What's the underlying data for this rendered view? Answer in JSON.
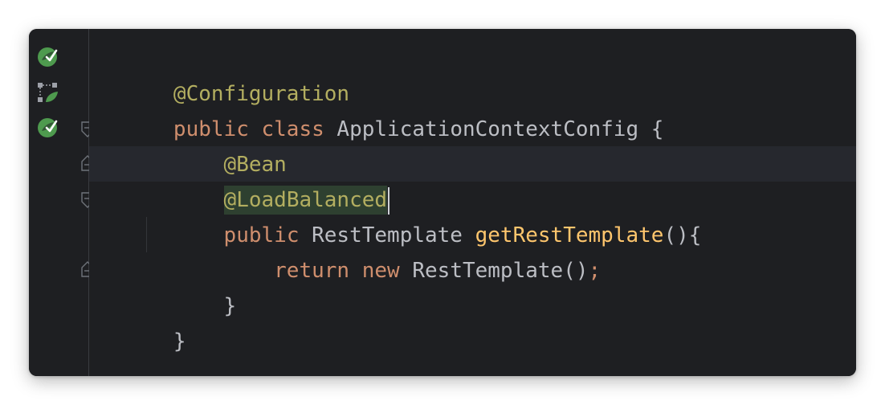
{
  "editor": {
    "lines": [
      {
        "tokens": [
          {
            "text": "@Configuration",
            "kind": "annotation"
          }
        ]
      },
      {
        "tokens": [
          {
            "text": "public",
            "kind": "keyword"
          },
          {
            "text": " ",
            "kind": "plain"
          },
          {
            "text": "class",
            "kind": "keyword"
          },
          {
            "text": " ApplicationContextConfig {",
            "kind": "plain"
          }
        ]
      },
      {
        "tokens": [
          {
            "text": "    ",
            "kind": "plain"
          },
          {
            "text": "@Bean",
            "kind": "annotation"
          }
        ]
      },
      {
        "tokens": [
          {
            "text": "    ",
            "kind": "plain"
          },
          {
            "text": "@LoadBalanced",
            "kind": "annotation"
          }
        ]
      },
      {
        "tokens": [
          {
            "text": "    ",
            "kind": "plain"
          },
          {
            "text": "public",
            "kind": "keyword"
          },
          {
            "text": " RestTemplate ",
            "kind": "plain"
          },
          {
            "text": "getRestTemplate",
            "kind": "method-decl"
          },
          {
            "text": "(){",
            "kind": "plain"
          }
        ]
      },
      {
        "tokens": [
          {
            "text": "        ",
            "kind": "plain"
          },
          {
            "text": "return",
            "kind": "keyword"
          },
          {
            "text": " ",
            "kind": "plain"
          },
          {
            "text": "new",
            "kind": "keyword"
          },
          {
            "text": " RestTemplate()",
            "kind": "plain"
          },
          {
            "text": ";",
            "kind": "semi"
          }
        ]
      },
      {
        "tokens": [
          {
            "text": "    }",
            "kind": "plain"
          }
        ]
      },
      {
        "tokens": [
          {
            "text": "}",
            "kind": "plain"
          }
        ]
      }
    ],
    "current_line_index": 3
  },
  "gutter": {
    "icons": [
      {
        "line_index": 0,
        "icon": "spring-bean-icon"
      },
      {
        "line_index": 1,
        "icon": "spring-config-icon"
      },
      {
        "line_index": 2,
        "icon": "spring-bean-icon"
      }
    ],
    "fold_markers": [
      {
        "line_index": 2,
        "type": "fold-start"
      },
      {
        "line_index": 3,
        "type": "fold-end"
      },
      {
        "line_index": 4,
        "type": "fold-start"
      },
      {
        "line_index": 6,
        "type": "fold-end"
      }
    ]
  },
  "colors": {
    "background": "#1e1f22",
    "annotation": "#b3ae60",
    "keyword": "#cf8e6d",
    "method_declaration": "#ffc66d",
    "plain": "#bcbec4",
    "current_line": "#26282e",
    "spring_green": "#4e9a4e"
  }
}
